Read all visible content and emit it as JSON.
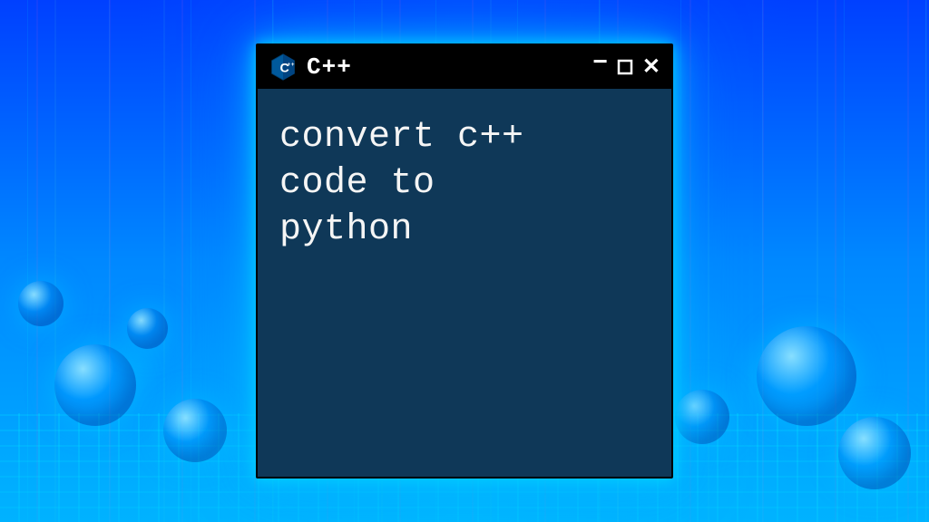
{
  "window": {
    "title": "C++",
    "icon_name": "cpp-hexagon-icon"
  },
  "content": {
    "text": "convert c++\ncode to\npython"
  },
  "controls": {
    "minimize": "−",
    "close": "✕"
  },
  "colors": {
    "window_body": "#0f3858",
    "titlebar": "#000000",
    "text": "#f5f5f5",
    "glow": "#00c8ff"
  }
}
